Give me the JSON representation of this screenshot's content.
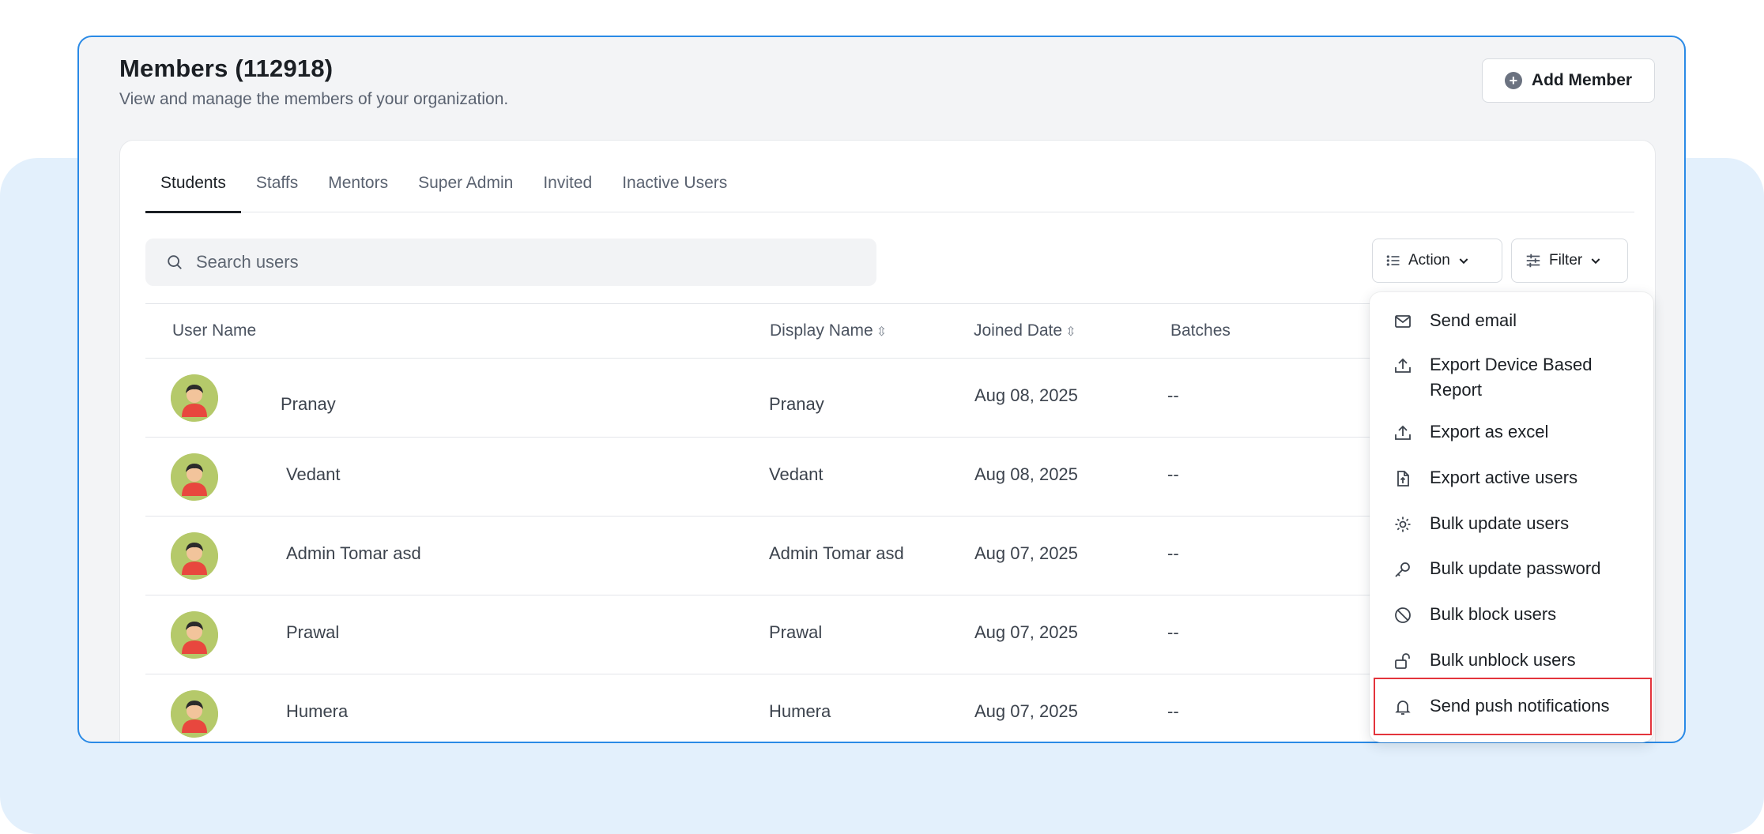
{
  "header": {
    "title": "Members (112918)",
    "subtitle": "View and manage the members of your organization.",
    "add_button": "Add Member"
  },
  "tabs": [
    {
      "label": "Students",
      "active": true
    },
    {
      "label": "Staffs"
    },
    {
      "label": "Mentors"
    },
    {
      "label": "Super Admin"
    },
    {
      "label": "Invited"
    },
    {
      "label": "Inactive Users"
    }
  ],
  "search": {
    "placeholder": "Search users"
  },
  "toolbar": {
    "action_label": "Action",
    "filter_label": "Filter"
  },
  "table": {
    "columns": {
      "user_name": "User Name",
      "display_name": "Display Name",
      "joined_date": "Joined Date",
      "batches": "Batches"
    },
    "rows": [
      {
        "user_name": "Pranay",
        "display_name": "Pranay",
        "joined": "Aug 08, 2025",
        "batches": "--"
      },
      {
        "user_name": "Vedant",
        "display_name": "Vedant",
        "joined": "Aug 08, 2025",
        "batches": "--"
      },
      {
        "user_name": "Admin Tomar asd",
        "display_name": "Admin Tomar asd",
        "joined": "Aug 07, 2025",
        "batches": "--"
      },
      {
        "user_name": "Prawal",
        "display_name": "Prawal",
        "joined": "Aug 07, 2025",
        "batches": "--"
      },
      {
        "user_name": "Humera",
        "display_name": "Humera",
        "joined": "Aug 07, 2025",
        "batches": "--"
      }
    ]
  },
  "action_menu": {
    "items": [
      {
        "label": "Send email",
        "icon": "mail-icon"
      },
      {
        "label": "Export Device Based Report",
        "icon": "upload-icon"
      },
      {
        "label": "Export as excel",
        "icon": "upload-icon"
      },
      {
        "label": "Export active users",
        "icon": "file-export-icon"
      },
      {
        "label": "Bulk update users",
        "icon": "users-gear-icon"
      },
      {
        "label": "Bulk update password",
        "icon": "key-icon"
      },
      {
        "label": "Bulk block users",
        "icon": "block-icon"
      },
      {
        "label": "Bulk unblock users",
        "icon": "unlock-icon"
      },
      {
        "label": "Send push notifications",
        "icon": "bell-icon",
        "highlighted": true
      }
    ]
  },
  "colors": {
    "accent_border": "#2a8ae6",
    "highlight": "#e3343c",
    "background_panel": "#e3f0fc"
  }
}
